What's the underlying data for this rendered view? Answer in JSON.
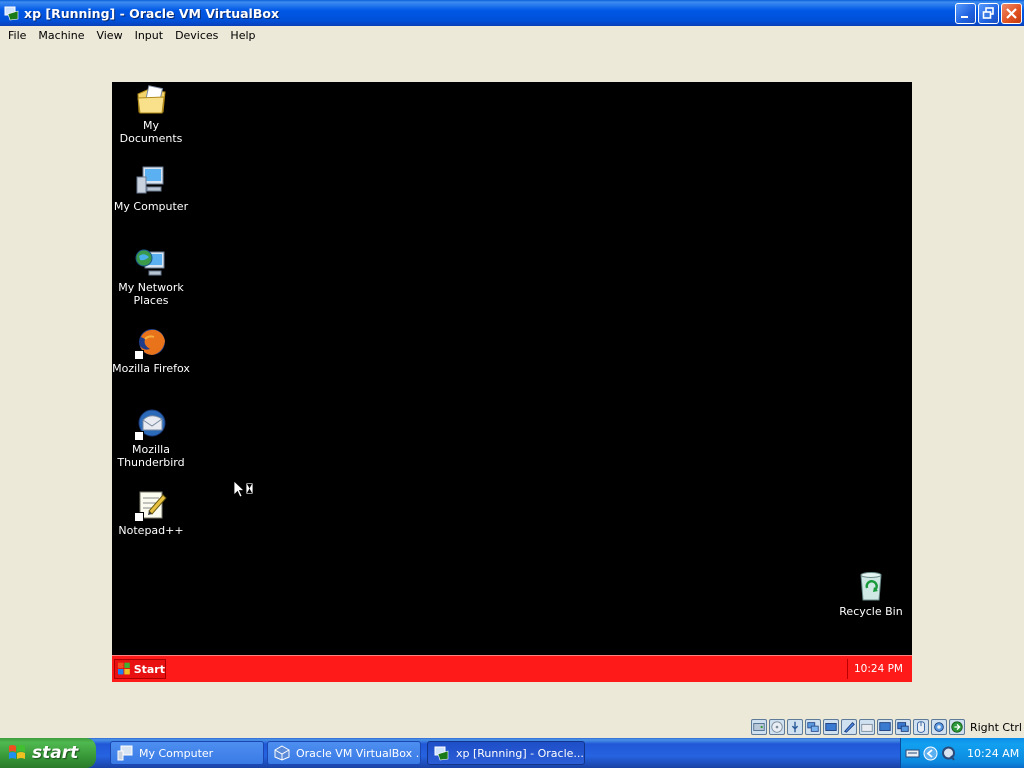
{
  "window": {
    "title": "xp [Running] - Oracle VM VirtualBox",
    "minimize_icon": "minimize-icon",
    "restore_icon": "restore-icon",
    "close_icon": "close-icon"
  },
  "menu": [
    "File",
    "Machine",
    "View",
    "Input",
    "Devices",
    "Help"
  ],
  "guest": {
    "background": "#000000",
    "icons": [
      {
        "label": "My Documents",
        "icon": "my-documents-icon"
      },
      {
        "label": "My Computer",
        "icon": "my-computer-icon"
      },
      {
        "label": "My Network Places",
        "icon": "my-network-places-icon"
      },
      {
        "label": "Mozilla Firefox",
        "icon": "firefox-icon"
      },
      {
        "label": "Mozilla Thunderbird",
        "icon": "thunderbird-icon"
      },
      {
        "label": "Notepad++",
        "icon": "notepad-plus-plus-icon"
      },
      {
        "label": "Recycle Bin",
        "icon": "recycle-bin-icon"
      }
    ],
    "taskbar": {
      "color": "#ff1a1a",
      "start_label": "Start",
      "clock": "10:24 PM"
    }
  },
  "vbox_status": {
    "icons": [
      "hard-disk-icon",
      "optical-drive-icon",
      "usb-icon",
      "shared-folders-icon",
      "network-icon",
      "pencil-icon",
      "folder-icon",
      "display-icon",
      "display-capture-icon",
      "mouse-integration-icon",
      "settings-icon",
      "green-arrow-icon"
    ],
    "host_key": "Right Ctrl"
  },
  "host_taskbar": {
    "start_label": "start",
    "tasks": [
      {
        "label": "My Computer",
        "icon": "my-computer-icon"
      },
      {
        "label": "Oracle VM VirtualBox ...",
        "icon": "virtualbox-icon"
      },
      {
        "label": "xp [Running] - Oracle...",
        "icon": "virtualbox-vm-icon"
      }
    ],
    "tray_icons": [
      "keyboard-icon",
      "back-arrow-icon",
      "quicktime-icon"
    ],
    "clock": "10:24 AM"
  }
}
